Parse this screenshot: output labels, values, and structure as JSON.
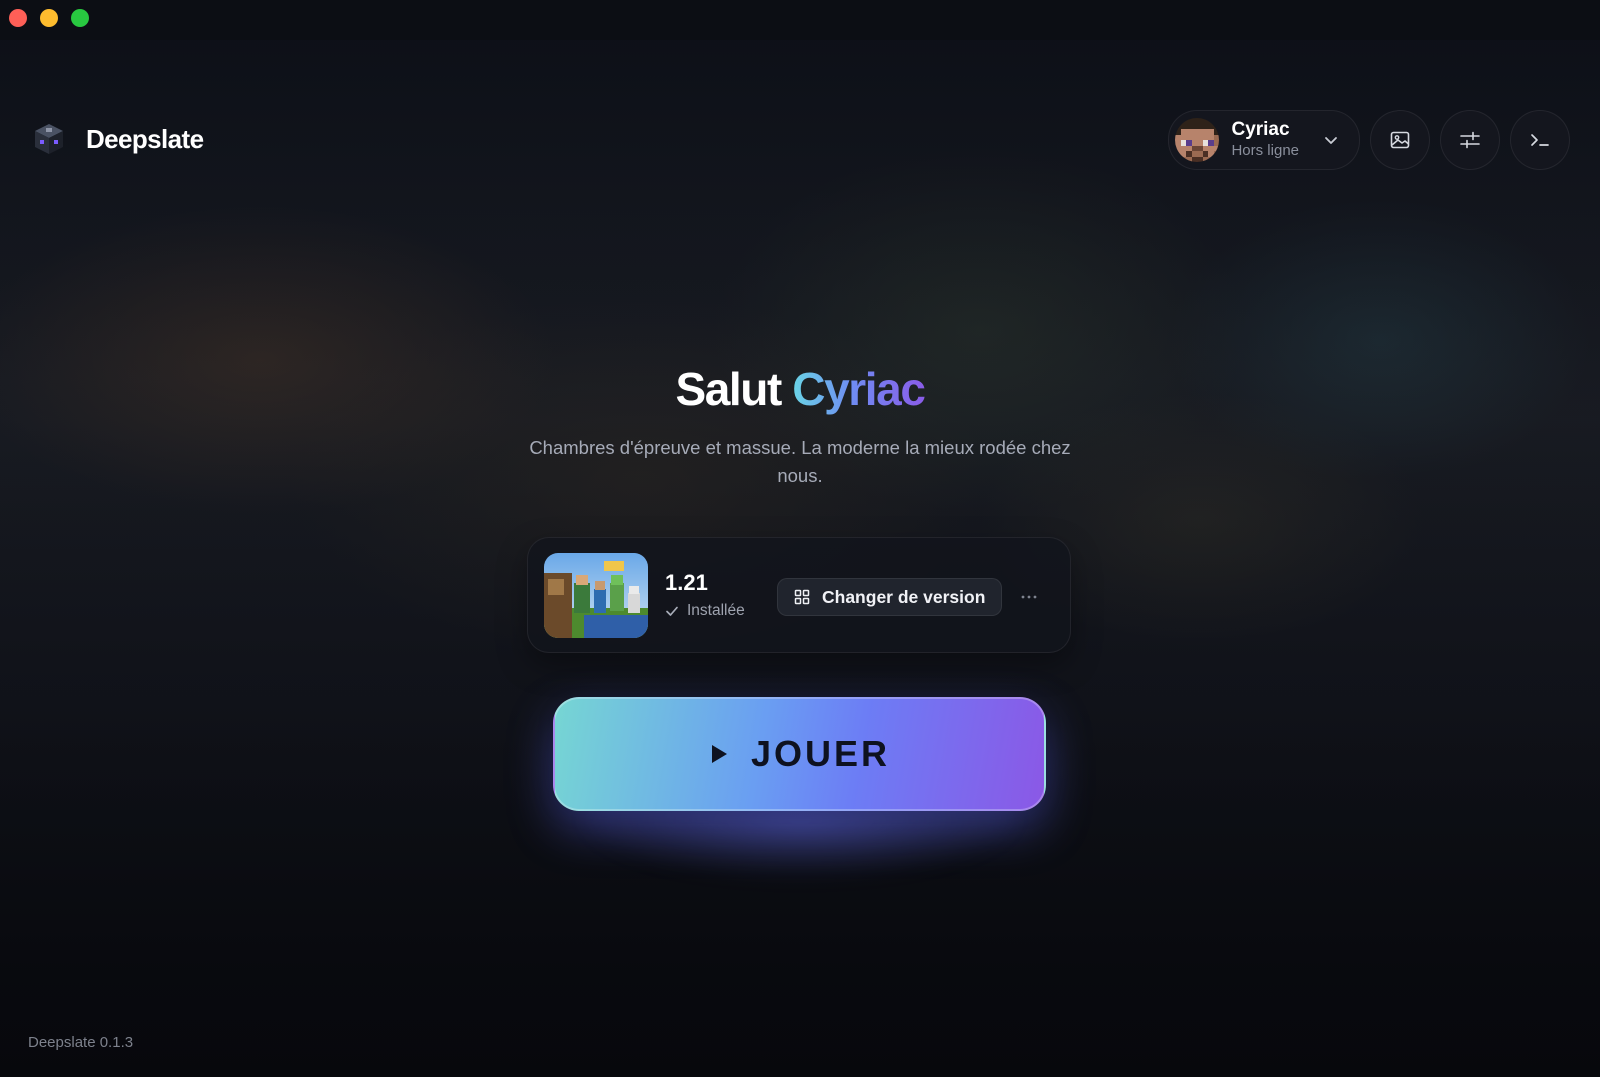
{
  "window": {
    "controls": [
      "close",
      "minimize",
      "zoom"
    ]
  },
  "brand": {
    "name": "Deepslate",
    "logo_icon": "deepslate-cube-icon"
  },
  "account": {
    "name": "Cyriac",
    "status": "Hors ligne",
    "avatar_icon": "player-head-avatar",
    "dropdown_icon": "chevron-down-icon"
  },
  "toolbar": {
    "buttons": [
      {
        "icon": "image-icon"
      },
      {
        "icon": "sliders-icon"
      },
      {
        "icon": "terminal-icon"
      }
    ]
  },
  "hero": {
    "greeting": "Salut",
    "name": "Cyriac",
    "tagline": "Chambres d'épreuve et massue. La moderne la mieux rodée chez nous."
  },
  "version_card": {
    "version": "1.21",
    "status": "Installée",
    "status_icon": "check-icon",
    "change_label": "Changer de version",
    "change_icon": "grid-icon",
    "more_icon": "more-horizontal-icon",
    "thumbnail": "version-artwork"
  },
  "play": {
    "label": "JOUER",
    "icon": "play-icon"
  },
  "footer": {
    "version_text": "Deepslate 0.1.3"
  },
  "colors": {
    "accent_start": "#76d6d3",
    "accent_mid": "#6c7df5",
    "accent_end": "#8b58e6",
    "background": "#0b0d14"
  }
}
